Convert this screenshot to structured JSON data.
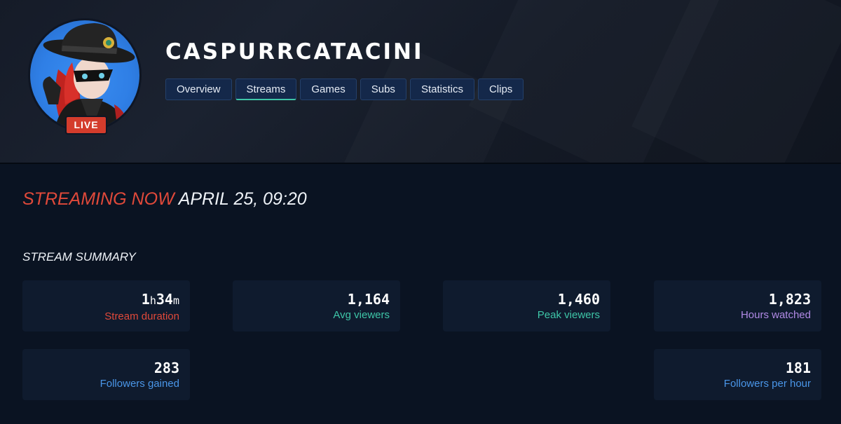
{
  "channel": {
    "name": "CASPURRCATACINI",
    "live_badge": "LIVE"
  },
  "tabs": [
    {
      "label": "Overview"
    },
    {
      "label": "Streams",
      "active": true
    },
    {
      "label": "Games"
    },
    {
      "label": "Subs"
    },
    {
      "label": "Statistics"
    },
    {
      "label": "Clips"
    }
  ],
  "headline": {
    "status": "STREAMING NOW",
    "date": "APRIL 25, 09:20"
  },
  "summary": {
    "title": "STREAM SUMMARY",
    "duration": {
      "hours": "1",
      "h_unit": "h",
      "minutes": "34",
      "m_unit": "m",
      "label": "Stream duration",
      "color": "#e0493a"
    },
    "avg_viewers": {
      "value": "1,164",
      "label": "Avg viewers",
      "color": "#3ec6a8"
    },
    "peak_viewers": {
      "value": "1,460",
      "label": "Peak viewers",
      "color": "#3ec6a8"
    },
    "hours_watched": {
      "value": "1,823",
      "label": "Hours watched",
      "color": "#b18ae6"
    },
    "followers_gained": {
      "value": "283",
      "label": "Followers gained",
      "color": "#4a96e8"
    },
    "followers_per_hour": {
      "value": "181",
      "label": "Followers per hour",
      "color": "#4a96e8"
    }
  },
  "colors": {
    "page_bg": "#0a1322",
    "card_bg": "#0f1b2e",
    "tab_bg": "#14284a",
    "tab_active_underline": "#3ec6a8",
    "live_red": "#d43c2c"
  }
}
